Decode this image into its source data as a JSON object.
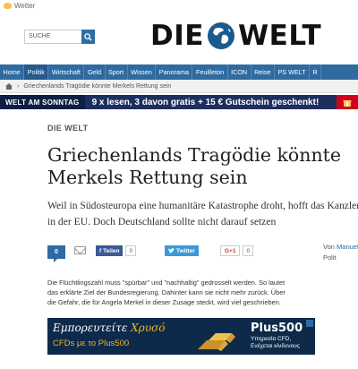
{
  "weather": {
    "label": "Wetter",
    "icon": "sun-cloud-icon"
  },
  "search": {
    "placeholder": "SUCHE",
    "icon": "search-icon"
  },
  "logo": {
    "left": "DIE",
    "right": "WELT",
    "icon": "globe-icon"
  },
  "nav": {
    "items": [
      "Home",
      "Politik",
      "Wirtschaft",
      "Geld",
      "Sport",
      "Wissen",
      "Panorama",
      "Feuilleton",
      "ICON",
      "Reise",
      "PS WELT",
      "R"
    ],
    "active_index": 1
  },
  "breadcrumb": {
    "text": "Griechenlands Tragödie könnte Merkels Rettung sein",
    "icon": "home-icon"
  },
  "promo": {
    "brand": "WELT AM SONNTAG",
    "text": "9 x lesen, 3 davon gratis + 15 € Gutschein geschenkt!",
    "gift_icon": "gift-icon"
  },
  "article": {
    "section": "DIE WELT",
    "headline_line1": "Griechenlands Tragödie könnte",
    "headline_line2": "Merkels Rettung sein",
    "lead_line1": "Weil in Südosteuropa eine humanitäre Katastrophe droht, hofft das Kanzleramt auf",
    "lead_line2": "in der EU. Doch Deutschland sollte nicht darauf setzen",
    "body_line1": "Die Flüchtlingszahl muss \"spürbar\" und \"nachhaltig\" gedrosselt werden. So lautet",
    "body_line2": "das erklärte Ziel der Bundesregierung. Dahinter kann sie nicht mehr zurück. Über",
    "body_line3": "die Gefahr, die für Angela Merkel in dieser Zusage steckt, wird viel geschrieben."
  },
  "social": {
    "comments_count": "0",
    "facebook_label": "Teilen",
    "facebook_count": "0",
    "twitter_label": "Twitter",
    "gplus_label": "G+1",
    "gplus_count": "0"
  },
  "byline": {
    "prefix": "Von",
    "author": "Manuel",
    "role": "Polit"
  },
  "ad": {
    "line1a": "Εμπορευτείτε ",
    "line1b": "Χρυσό",
    "line2": "CFDs με το Plus500",
    "brand": "Plus500",
    "sub1": "Υπηρεσία CFD,",
    "sub2": "Ενέχεται κίνδυνους"
  }
}
